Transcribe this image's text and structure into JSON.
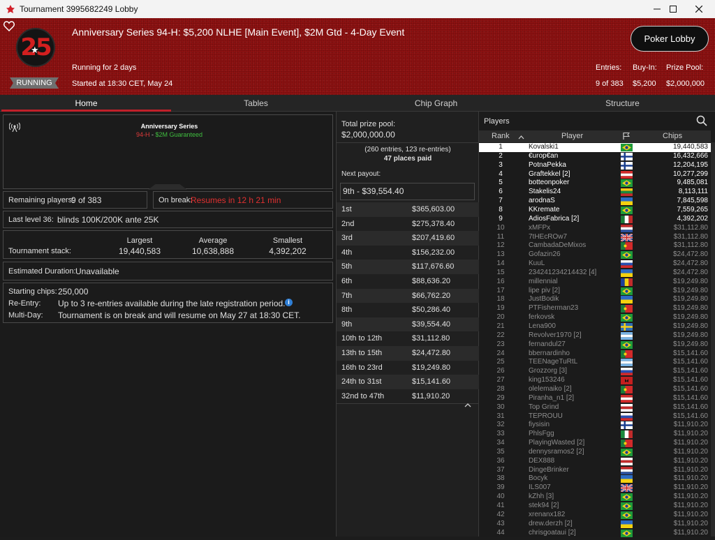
{
  "window": {
    "title": "Tournament 3995682249 Lobby"
  },
  "header": {
    "badge_number": "25",
    "status": "RUNNING",
    "title": "Anniversary Series 94-H: $5,200 NLHE [Main Event], $2M Gtd - 4-Day Event",
    "running_for": "Running for 2 days",
    "started_at": "Started at 18:30 CET, May 24",
    "lobby_button": "Poker Lobby",
    "entries_label": "Entries:",
    "entries_value": "9 of 383",
    "buyin_label": "Buy-In:",
    "buyin_value": "$5,200",
    "prize_label": "Prize Pool:",
    "prize_value": "$2,000,000"
  },
  "tabs": [
    "Home",
    "Tables",
    "Chip Graph",
    "Structure"
  ],
  "home": {
    "series_name": "Anniversary Series",
    "series_event": "94-H",
    "series_sep": " - ",
    "series_gtd": "$2M Guaranteed",
    "remaining_label": "Remaining players:",
    "remaining_value": "9 of 383",
    "break_label": "On break:",
    "break_value": "Resumes in 12 h 21 min",
    "last_level_label": "Last level 36:",
    "last_level_value": "blinds 100K/200K ante 25K",
    "stack_label": "Tournament stack:",
    "largest_label": "Largest",
    "largest_value": "19,440,583",
    "average_label": "Average",
    "average_value": "10,638,888",
    "smallest_label": "Smallest",
    "smallest_value": "4,392,202",
    "duration_label": "Estimated Duration:",
    "duration_value": "Unavailable",
    "starting_label": "Starting chips:",
    "starting_value": "250,000",
    "reentry_label": "Re-Entry:",
    "reentry_value": "Up to 3 re-entries available during the late registration period.",
    "multiday_label": "Multi-Day:",
    "multiday_value": "Tournament is on break and will resume on May 27 at 18:30 CET."
  },
  "prizes": {
    "pool_label": "Total prize pool:",
    "pool_value": "$2,000,000.00",
    "entries_text": "(260 entries, 123 re-entries)",
    "places_text": "47 places paid",
    "next_label": "Next payout:",
    "next_value": "9th - $39,554.40",
    "payouts": [
      {
        "place": "1st",
        "amount": "$365,603.00"
      },
      {
        "place": "2nd",
        "amount": "$275,378.40"
      },
      {
        "place": "3rd",
        "amount": "$207,419.60"
      },
      {
        "place": "4th",
        "amount": "$156,232.00"
      },
      {
        "place": "5th",
        "amount": "$117,676.60"
      },
      {
        "place": "6th",
        "amount": "$88,636.20"
      },
      {
        "place": "7th",
        "amount": "$66,762.20"
      },
      {
        "place": "8th",
        "amount": "$50,286.40"
      },
      {
        "place": "9th",
        "amount": "$39,554.40"
      },
      {
        "place": "10th to 12th",
        "amount": "$31,112.80"
      },
      {
        "place": "13th to 15th",
        "amount": "$24,472.80"
      },
      {
        "place": "16th to 23rd",
        "amount": "$19,249.80"
      },
      {
        "place": "24th to 31st",
        "amount": "$15,141.60"
      },
      {
        "place": "32nd to 47th",
        "amount": "$11,910.20"
      }
    ]
  },
  "players": {
    "title": "Players",
    "col_rank": "Rank",
    "col_player": "Player",
    "col_chips": "Chips",
    "rows": [
      {
        "rank": "1",
        "name": "Kovalski1",
        "chips": "19,440,583",
        "flag": "br",
        "live": true
      },
      {
        "rank": "2",
        "name": "€urop€an",
        "chips": "16,432,666",
        "flag": "fi",
        "live": true
      },
      {
        "rank": "3",
        "name": "PotnaPekka",
        "chips": "12,204,195",
        "flag": "fi",
        "live": true
      },
      {
        "rank": "4",
        "name": "Graftekkel [2]",
        "chips": "10,277,299",
        "flag": "at",
        "live": true
      },
      {
        "rank": "5",
        "name": "botteonpoker",
        "chips": "9,485,081",
        "flag": "br",
        "live": true
      },
      {
        "rank": "6",
        "name": "Stakelis24",
        "chips": "8,113,111",
        "flag": "lt",
        "live": true
      },
      {
        "rank": "7",
        "name": "arodnaS",
        "chips": "7,845,598",
        "flag": "ua",
        "live": true
      },
      {
        "rank": "8",
        "name": "KKremate",
        "chips": "7,559,265",
        "flag": "br",
        "live": true
      },
      {
        "rank": "9",
        "name": "AdiosFabrica [2]",
        "chips": "4,392,202",
        "flag": "mx",
        "live": true
      },
      {
        "rank": "10",
        "name": "xMFPx",
        "chips": "$31,112.80",
        "flag": "nl",
        "live": false
      },
      {
        "rank": "11",
        "name": "7tHEcROw7",
        "chips": "$31,112.80",
        "flag": "gb",
        "live": false
      },
      {
        "rank": "12",
        "name": "CambadaDeMixos",
        "chips": "$31,112.80",
        "flag": "pt",
        "live": false
      },
      {
        "rank": "13",
        "name": "Gofazin26",
        "chips": "$24,472.80",
        "flag": "br",
        "live": false
      },
      {
        "rank": "14",
        "name": "KuuL",
        "chips": "$24,472.80",
        "flag": "ru",
        "live": false
      },
      {
        "rank": "15",
        "name": "234241234214432 [4]",
        "chips": "$24,472.80",
        "flag": "ua",
        "live": false
      },
      {
        "rank": "16",
        "name": "millennial",
        "chips": "$19,249.80",
        "flag": "ro",
        "live": false
      },
      {
        "rank": "17",
        "name": "lipe piv [2]",
        "chips": "$19,249.80",
        "flag": "br",
        "live": false
      },
      {
        "rank": "18",
        "name": "JustBodik",
        "chips": "$19,249.80",
        "flag": "ua",
        "live": false
      },
      {
        "rank": "19",
        "name": "PTFisherman23",
        "chips": "$19,249.80",
        "flag": "pt",
        "live": false
      },
      {
        "rank": "20",
        "name": "ferkovsk",
        "chips": "$19,249.80",
        "flag": "br",
        "live": false
      },
      {
        "rank": "21",
        "name": "Lena900",
        "chips": "$19,249.80",
        "flag": "se",
        "live": false
      },
      {
        "rank": "22",
        "name": "Revolver1970 [2]",
        "chips": "$19,249.80",
        "flag": "ar",
        "live": false
      },
      {
        "rank": "23",
        "name": "fernandul27",
        "chips": "$19,249.80",
        "flag": "br",
        "live": false
      },
      {
        "rank": "24",
        "name": "bbernardinho",
        "chips": "$15,141.60",
        "flag": "pt",
        "live": false
      },
      {
        "rank": "25",
        "name": "TEENageTuRtL",
        "chips": "$15,141.60",
        "flag": "ar",
        "live": false
      },
      {
        "rank": "26",
        "name": "Grozzorg [3]",
        "chips": "$15,141.60",
        "flag": "ru",
        "live": false
      },
      {
        "rank": "27",
        "name": "king153246",
        "chips": "$15,141.60",
        "flag": "al",
        "live": false
      },
      {
        "rank": "28",
        "name": "olelemaiko [2]",
        "chips": "$15,141.60",
        "flag": "pt",
        "live": false
      },
      {
        "rank": "29",
        "name": "Piranha_n1 [2]",
        "chips": "$15,141.60",
        "flag": "at",
        "live": false
      },
      {
        "rank": "30",
        "name": "Top Grind",
        "chips": "$15,141.60",
        "flag": "pe",
        "live": false
      },
      {
        "rank": "31",
        "name": "TEPROUU",
        "chips": "$15,141.60",
        "flag": "ru",
        "live": false
      },
      {
        "rank": "32",
        "name": "fiysisin",
        "chips": "$11,910.20",
        "flag": "fi",
        "live": false
      },
      {
        "rank": "33",
        "name": "PhlsFgg",
        "chips": "$11,910.20",
        "flag": "it",
        "live": false
      },
      {
        "rank": "34",
        "name": "PlayingWasted [2]",
        "chips": "$11,910.20",
        "flag": "pt",
        "live": false
      },
      {
        "rank": "35",
        "name": "dennysramos2 [2]",
        "chips": "$11,910.20",
        "flag": "br",
        "live": false
      },
      {
        "rank": "36",
        "name": "DEX888",
        "chips": "$11,910.20",
        "flag": "pe",
        "live": false
      },
      {
        "rank": "37",
        "name": "DingeBrinker",
        "chips": "$11,910.20",
        "flag": "nl",
        "live": false
      },
      {
        "rank": "38",
        "name": "Bocyk",
        "chips": "$11,910.20",
        "flag": "ua",
        "live": false
      },
      {
        "rank": "39",
        "name": "ILS007",
        "chips": "$11,910.20",
        "flag": "gb",
        "live": false
      },
      {
        "rank": "40",
        "name": "kZhh [3]",
        "chips": "$11,910.20",
        "flag": "br",
        "live": false
      },
      {
        "rank": "41",
        "name": "stek94 [2]",
        "chips": "$11,910.20",
        "flag": "br",
        "live": false
      },
      {
        "rank": "42",
        "name": "xrenanx182",
        "chips": "$11,910.20",
        "flag": "br",
        "live": false
      },
      {
        "rank": "43",
        "name": "drew.derzh [2]",
        "chips": "$11,910.20",
        "flag": "ua",
        "live": false
      },
      {
        "rank": "44",
        "name": "chrisgoataui [2]",
        "chips": "$11,910.20",
        "flag": "br",
        "live": false
      }
    ]
  },
  "colors": {
    "header_red": "#8d1111",
    "accent": "#c0202a",
    "break_text": "#e03030",
    "info_blue": "#2f7fd6"
  }
}
